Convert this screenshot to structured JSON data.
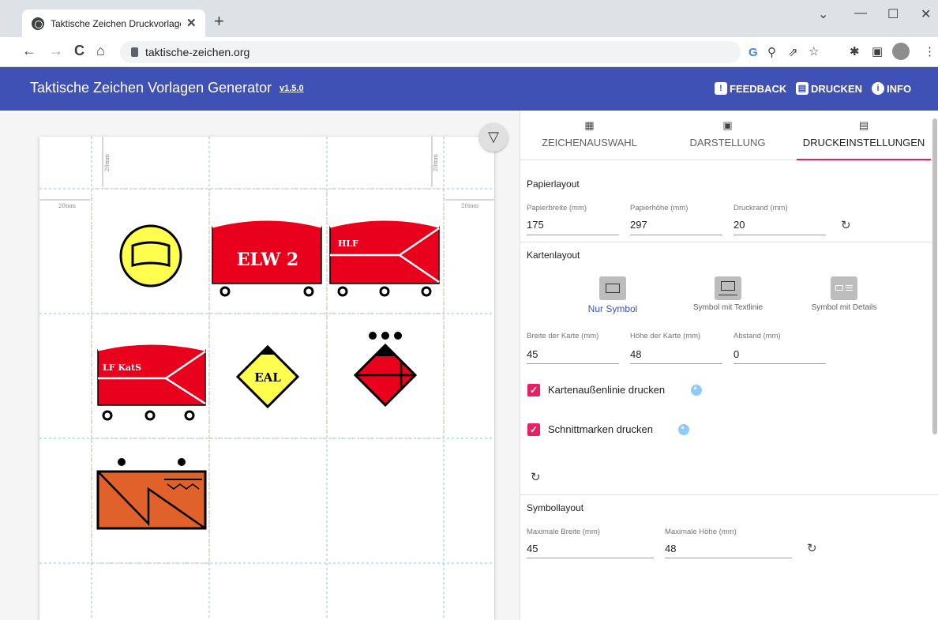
{
  "browser": {
    "tab_title": "Taktische Zeichen Druckvorlagen",
    "tab_close": "✕",
    "new_tab": "+",
    "url": "taktische-zeichen.org",
    "window_controls": [
      "⌄",
      "—",
      "☐",
      "✕"
    ]
  },
  "header": {
    "title": "Taktische Zeichen Vorlagen Generator",
    "version": "v1.5.0",
    "buttons": [
      {
        "label": "FEEDBACK",
        "icon": "feedback-icon"
      },
      {
        "label": "DRUCKEN",
        "icon": "print-icon"
      },
      {
        "label": "INFO",
        "icon": "info-icon"
      }
    ]
  },
  "preview": {
    "margin_label": "20mm",
    "symbols": [
      {
        "name": "yellow-circle-symbol",
        "text": ""
      },
      {
        "name": "elw2-vehicle-symbol",
        "text": "ELW 2"
      },
      {
        "name": "hlf-vehicle-symbol",
        "text": "HLF"
      },
      {
        "name": "lf-kats-vehicle-symbol",
        "text": "LF KatS"
      },
      {
        "name": "eal-diamond-symbol",
        "text": "EAL"
      },
      {
        "name": "red-diamond-symbol",
        "text": ""
      },
      {
        "name": "orange-unit-symbol",
        "text": ""
      }
    ]
  },
  "panel": {
    "tabs": [
      {
        "label": "ZEICHENAUSWAHL",
        "icon": "grid-icon"
      },
      {
        "label": "DARSTELLUNG",
        "icon": "search-image-icon"
      },
      {
        "label": "DRUCKEINSTELLUNGEN",
        "icon": "printer-icon",
        "active": true
      }
    ],
    "papierlayout": {
      "title": "Papierlayout",
      "fields": [
        {
          "label": "Papierbreite (mm)",
          "value": "175"
        },
        {
          "label": "Papierhöhe (mm)",
          "value": "297"
        },
        {
          "label": "Druckrand (mm)",
          "value": "20"
        }
      ]
    },
    "kartenlayout": {
      "title": "Kartenlayout",
      "options": [
        {
          "label": "Nur Symbol",
          "selected": true
        },
        {
          "label": "Symbol mit Textlinie"
        },
        {
          "label": "Symbol mit Details"
        }
      ],
      "fields": [
        {
          "label": "Breite der Karte (mm)",
          "value": "45"
        },
        {
          "label": "Höhe der Karte (mm)",
          "value": "48"
        },
        {
          "label": "Abstand (mm)",
          "value": "0"
        }
      ],
      "checkboxes": [
        {
          "label": "Kartenaußenlinie drucken",
          "checked": true
        },
        {
          "label": "Schnittmarken drucken",
          "checked": true
        }
      ]
    },
    "symbollayout": {
      "title": "Symbollayout",
      "fields": [
        {
          "label": "Maximale Breite (mm)",
          "value": "45"
        },
        {
          "label": "Maximale Höhe (mm)",
          "value": "48"
        }
      ]
    }
  },
  "colors": {
    "appbar": "#3f51b5",
    "accent": "#e91e63",
    "vehicle_red": "#e8001c",
    "symbol_yellow": "#ffff4d",
    "symbol_orange": "#e0622a"
  }
}
